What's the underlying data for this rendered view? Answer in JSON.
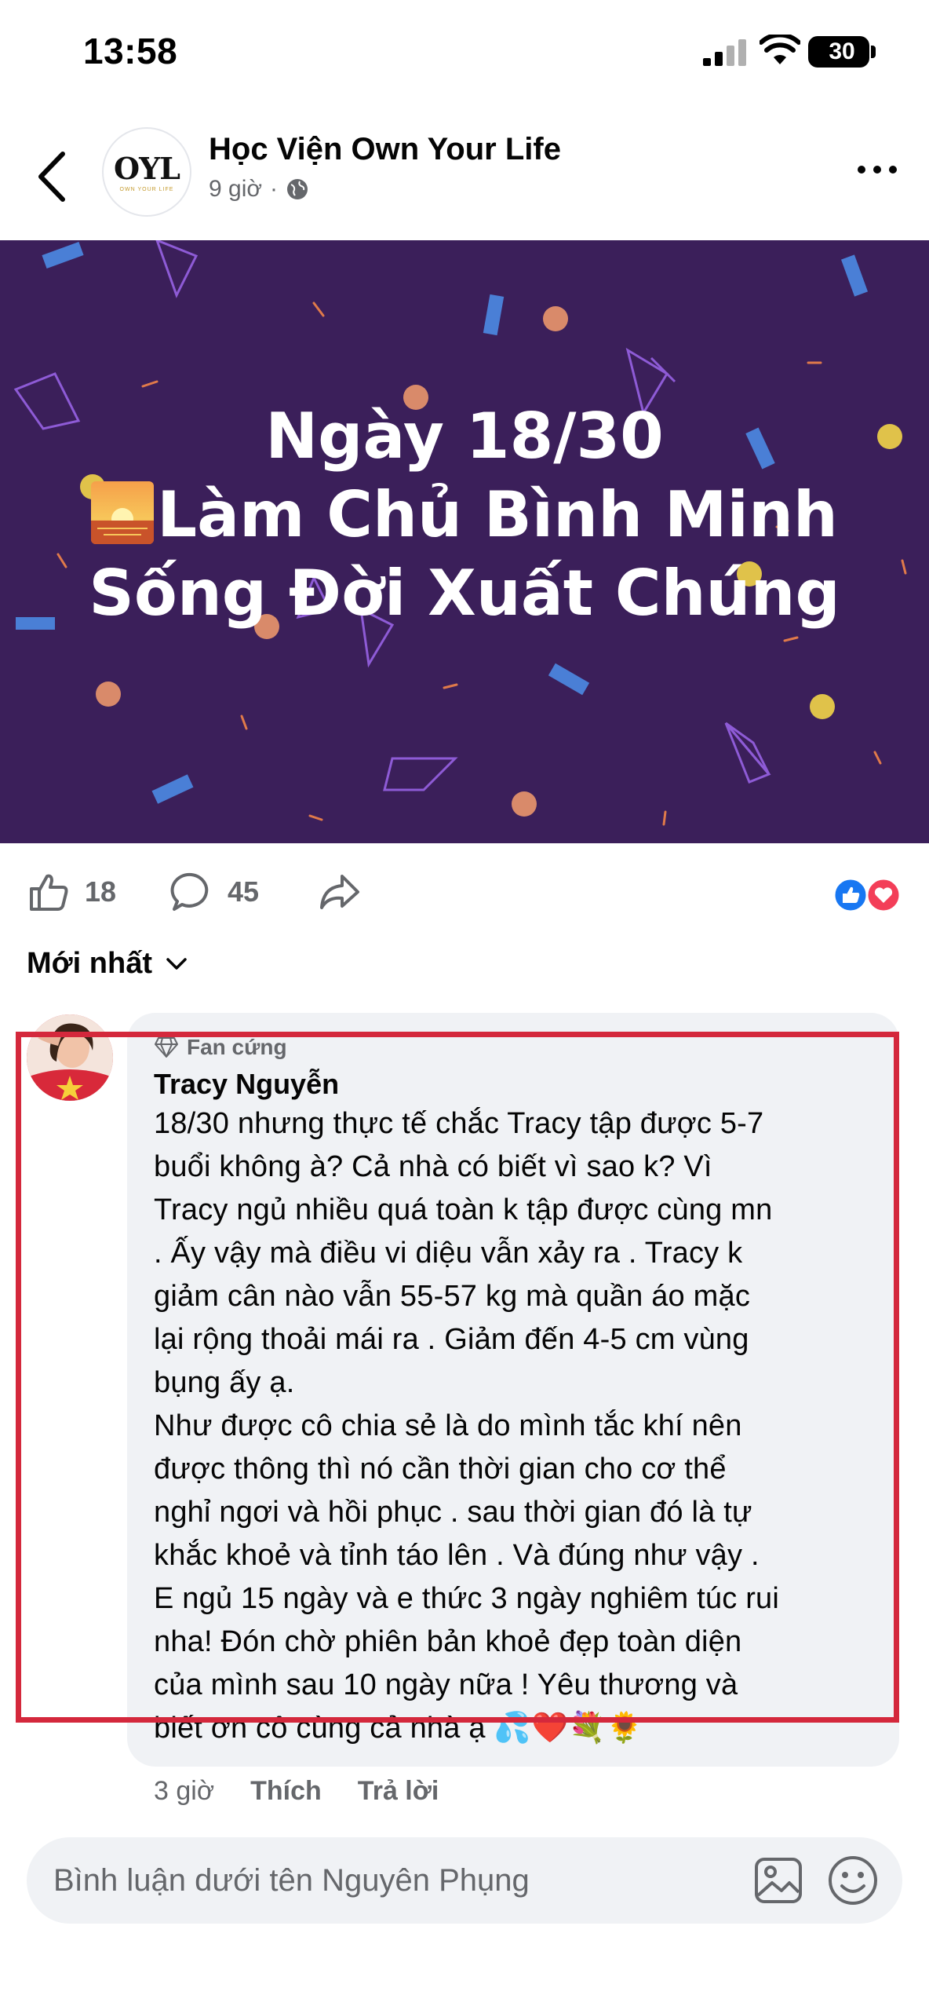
{
  "status": {
    "time": "13:58",
    "battery": "30"
  },
  "header": {
    "page_name": "Học Viện Own Your Life",
    "time_ago": "9 giờ",
    "meta_sep": "·",
    "logo_text": "OYL",
    "logo_sub": "OWN YOUR LIFE"
  },
  "banner": {
    "line1": "Ngày 18/30",
    "line2": "Làm Chủ Bình Minh",
    "line3": "Sống Đời Xuất Chúng",
    "colors": {
      "background": "#3b1f5a",
      "text": "#ffffff"
    }
  },
  "actions": {
    "likes": "18",
    "comments": "45",
    "reactions": [
      "like-icon",
      "love-icon"
    ]
  },
  "sort": {
    "label": "Mới nhất"
  },
  "comment": {
    "badge": "Fan cứng",
    "author": "Tracy Nguyễn",
    "text": "18/30 nhưng thực tế chắc Tracy tập được 5-7\nbuổi không à? Cả nhà có biết vì sao k? Vì\nTracy ngủ nhiều quá toàn k tập được cùng mn\n. Ấy vậy mà điều vi diệu vẫn xảy ra . Tracy k\ngiảm cân nào vẫn 55-57 kg mà quần áo mặc\nlại rộng thoải mái ra . Giảm đến 4-5 cm vùng\nbụng ấy ạ.\nNhư được cô chia sẻ là do mình tắc khí nên\nđược thông thì nó cần thời gian cho cơ thể\nnghỉ ngơi và hồi phục . sau thời gian đó là tự\nkhắc khoẻ và tỉnh táo lên . Và đúng như vậy .\nE ngủ 15 ngày và e thức 3 ngày nghiêm túc rui\nnha! Đón chờ phiên bản khoẻ đẹp toàn diện\ncủa mình sau 10 ngày nữa ! Yêu thương và\nbiết ơn cô cùng cả nhà ạ 💦❤️💐🌻",
    "time_ago": "3 giờ",
    "like_label": "Thích",
    "reply_label": "Trả lời",
    "highlight_color": "#d4283c"
  },
  "composer": {
    "placeholder": "Bình luận dưới tên Nguyên Phụng"
  }
}
